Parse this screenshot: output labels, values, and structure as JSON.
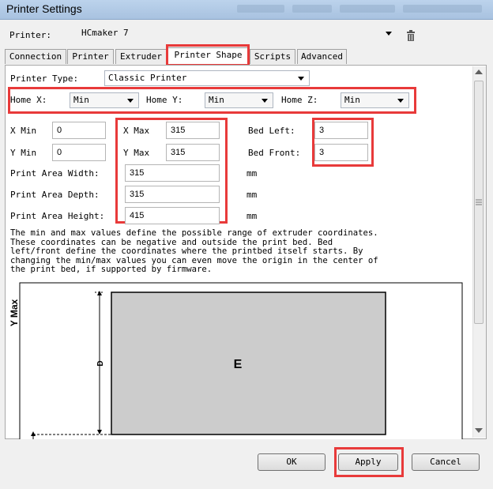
{
  "window": {
    "title": "Printer Settings"
  },
  "printer": {
    "label": "Printer:",
    "value": "HCmaker 7"
  },
  "tabs": [
    "Connection",
    "Printer",
    "Extruder",
    "Printer Shape",
    "Scripts",
    "Advanced"
  ],
  "active_tab": "Printer Shape",
  "shape": {
    "printer_type_label": "Printer Type:",
    "printer_type_value": "Classic Printer",
    "home_x_label": "Home X:",
    "home_x_value": "Min",
    "home_y_label": "Home Y:",
    "home_y_value": "Min",
    "home_z_label": "Home Z:",
    "home_z_value": "Min",
    "x_min_label": "X Min",
    "x_min_value": "0",
    "y_min_label": "Y Min",
    "y_min_value": "0",
    "x_max_label": "X Max",
    "x_max_value": "315",
    "y_max_label": "Y Max",
    "y_max_value": "315",
    "bed_left_label": "Bed Left:",
    "bed_left_value": "3",
    "bed_front_label": "Bed Front:",
    "bed_front_value": "3",
    "width_label": "Print Area Width:",
    "width_value": "315",
    "depth_label": "Print Area Depth:",
    "depth_value": "315",
    "height_label": "Print Area Height:",
    "height_value": "415",
    "unit": "mm",
    "description": "The min and max values define the possible range of extruder coordinates.\nThese coordinates can be negative and outside the print bed. Bed\nleft/front define the coordinates where the printbed itself starts. By\nchanging the min/max values you can even move the origin in the center of\nthe print bed, if supported by firmware."
  },
  "diagram": {
    "y_axis_label": "Y Max",
    "side_letter": "D",
    "bed_letter": "E"
  },
  "buttons": {
    "ok": "OK",
    "apply": "Apply",
    "cancel": "Cancel"
  },
  "colors": {
    "highlight": "#e83a3a",
    "bed_fill": "#cccccc"
  },
  "icons": {
    "delete": "trash-icon"
  }
}
